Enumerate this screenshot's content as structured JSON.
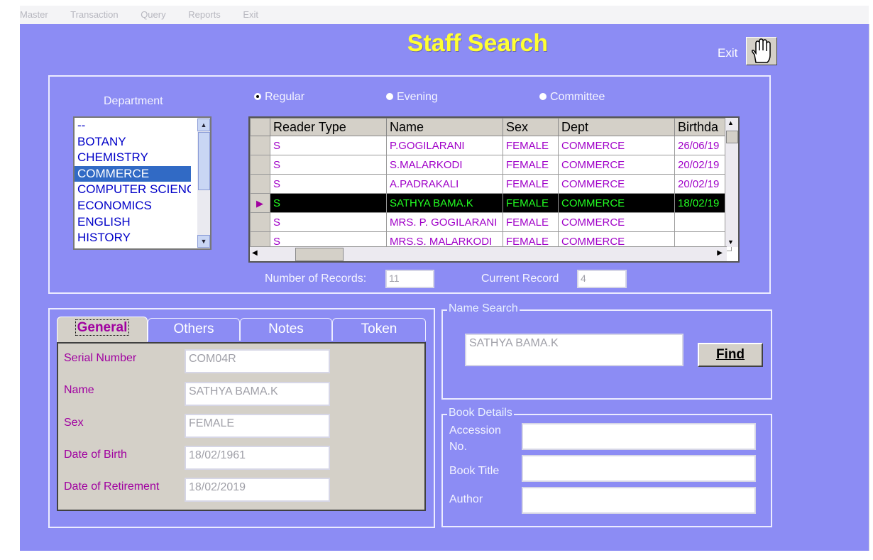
{
  "menu": [
    "Master",
    "Transaction",
    "Query",
    "Reports",
    "Exit"
  ],
  "title": "Staff Search",
  "exit_label": "Exit",
  "department": {
    "label": "Department",
    "items": [
      "--",
      "BOTANY",
      "CHEMISTRY",
      "COMMERCE",
      "COMPUTER SCIENCE",
      "ECONOMICS",
      "ENGLISH",
      "HISTORY"
    ],
    "selected": "COMMERCE"
  },
  "radios": [
    {
      "label": "Regular",
      "checked": true
    },
    {
      "label": "Evening",
      "checked": false
    },
    {
      "label": "Committee",
      "checked": false
    }
  ],
  "grid": {
    "columns": [
      "Reader Type",
      "Name",
      "Sex",
      "Dept",
      "Birthda"
    ],
    "rows": [
      {
        "reader_type": "S",
        "name": "P.GOGILARANI",
        "sex": "FEMALE",
        "dept": "COMMERCE",
        "birth": "26/06/19"
      },
      {
        "reader_type": "S",
        "name": "S.MALARKODI",
        "sex": "FEMALE",
        "dept": "COMMERCE",
        "birth": "20/02/19"
      },
      {
        "reader_type": "S",
        "name": "A.PADRAKALI",
        "sex": "FEMALE",
        "dept": "COMMERCE",
        "birth": "20/02/19"
      },
      {
        "reader_type": "S",
        "name": "SATHYA BAMA.K",
        "sex": "FEMALE",
        "dept": "COMMERCE",
        "birth": "18/02/19",
        "current": true
      },
      {
        "reader_type": "S",
        "name": "MRS. P. GOGILARANI",
        "sex": "FEMALE",
        "dept": "COMMERCE",
        "birth": ""
      },
      {
        "reader_type": "S",
        "name": "MRS.S. MALARKODI",
        "sex": "FEMALE",
        "dept": "COMMERCE",
        "birth": ""
      }
    ]
  },
  "records": {
    "count_label": "Number of Records:",
    "count": "11",
    "current_label": "Current Record",
    "current": "4"
  },
  "tabs": [
    "General",
    "Others",
    "Notes",
    "Token"
  ],
  "general": {
    "serial_label": "Serial Number",
    "serial": "COM04R",
    "name_label": "Name",
    "name": "SATHYA BAMA.K",
    "sex_label": "Sex",
    "sex": "FEMALE",
    "dob_label": "Date of Birth",
    "dob": "18/02/1961",
    "dor_label": "Date of Retirement",
    "dor": "18/02/2019"
  },
  "name_search": {
    "legend": "Name Search",
    "value": "SATHYA BAMA.K",
    "find_label": "Find",
    "find_underline": "F"
  },
  "book_details": {
    "legend": "Book Details",
    "accession_label_1": "Accession",
    "accession_label_2": "No.",
    "title_label": "Book Title",
    "author_label": "Author",
    "accession": "",
    "title": "",
    "author": ""
  },
  "colors": {
    "background": "#8c8cf4",
    "title": "#ffff33",
    "selection": "#316ac5",
    "grid_text": "#a000c8",
    "current_row_text": "#22ff22"
  }
}
